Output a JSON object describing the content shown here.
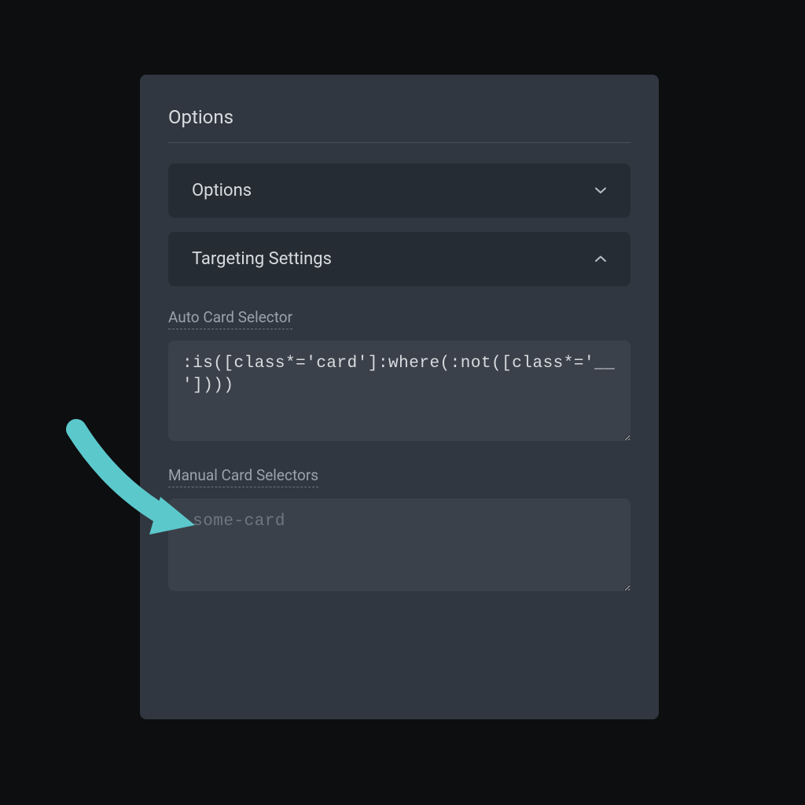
{
  "panel": {
    "title": "Options",
    "accordions": [
      {
        "label": "Options",
        "expanded": false
      },
      {
        "label": "Targeting Settings",
        "expanded": true
      }
    ],
    "fields": {
      "auto_selector": {
        "label": "Auto Card Selector",
        "value": ":is([class*='card']:where(:not([class*='__'])))"
      },
      "manual_selectors": {
        "label": "Manual Card Selectors",
        "placeholder": ".some-card",
        "value": ""
      }
    }
  },
  "annotation": {
    "arrow_color": "#5bc8cc"
  }
}
